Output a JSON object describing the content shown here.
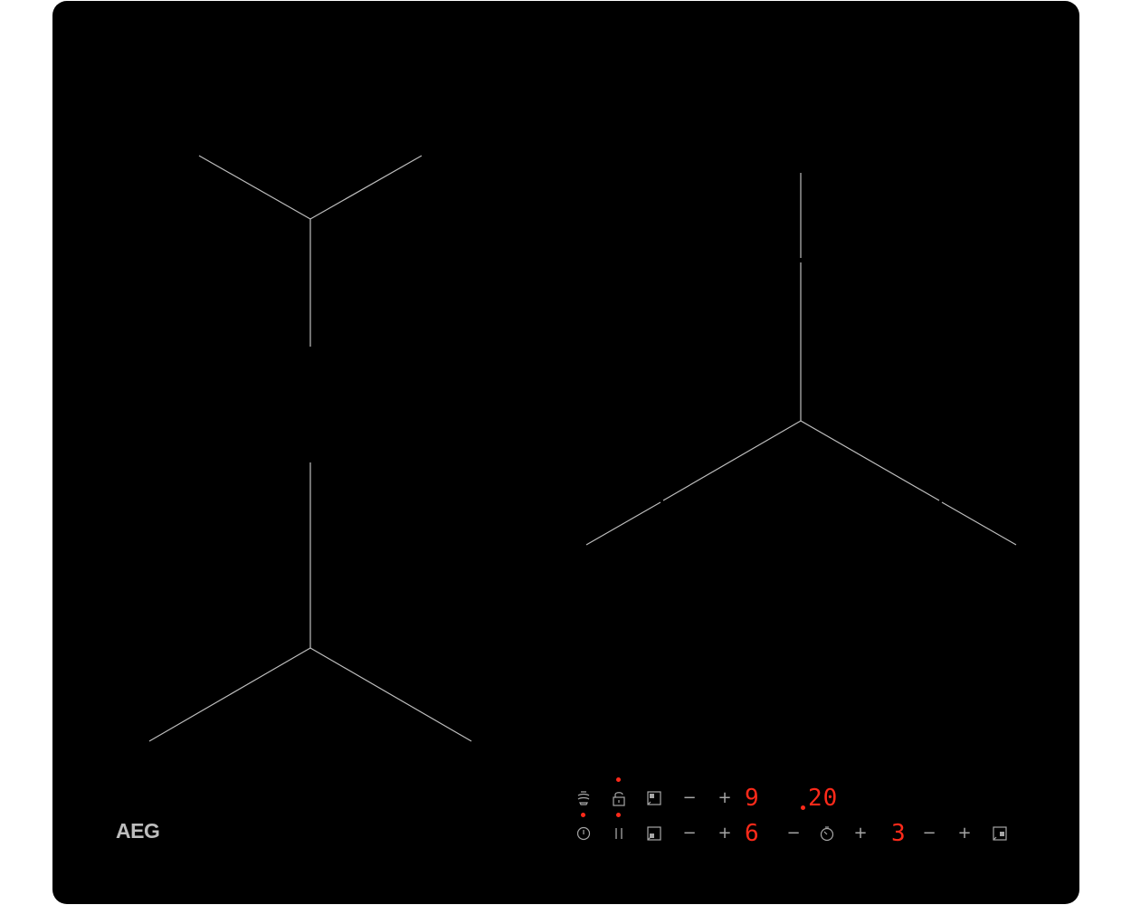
{
  "hob": {
    "brand": "AEG",
    "zones_count": 3
  },
  "controls": {
    "row1": {
      "zone_a_level": "9",
      "timer_value": "20"
    },
    "row2": {
      "zone_b_level": "6",
      "zone_c_level": "3"
    },
    "minus_symbol": "−",
    "plus_symbol": "+"
  },
  "icons": [
    "hob2hood-icon",
    "lock-icon",
    "zone-select-icon",
    "power-icon",
    "pause-icon",
    "timer-icon"
  ],
  "colors": {
    "glass": "#000000",
    "marking": "#bdbdbd",
    "display": "#ff2a1a",
    "symbols": "#a6a6a6"
  }
}
